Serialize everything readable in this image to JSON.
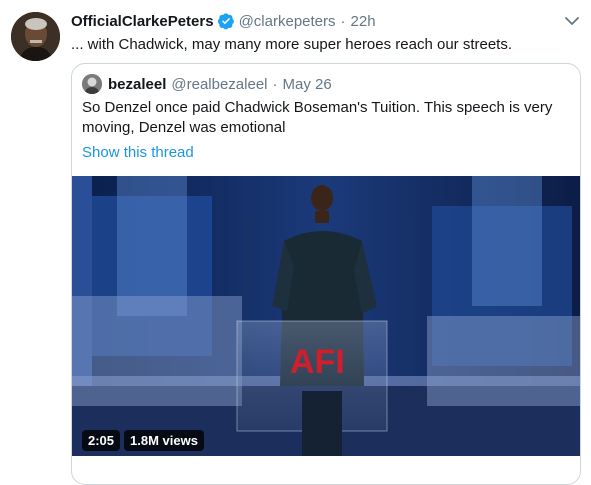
{
  "tweet": {
    "display_name": "OfficialClarkePeters",
    "handle": "@clarkepeters",
    "separator": "·",
    "time": "22h",
    "text": "... with Chadwick, may many more super heroes reach our streets."
  },
  "quoted": {
    "display_name": "bezaleel",
    "handle": "@realbezaleel",
    "separator": "·",
    "date": "May 26",
    "text": "So Denzel once paid Chadwick Boseman's Tuition. This speech is very moving, Denzel was emotional",
    "thread_link": "Show this thread"
  },
  "video": {
    "duration": "2:05",
    "views": "1.8M views",
    "podium_logo": "AFI"
  },
  "colors": {
    "link": "#1b95e0",
    "secondary_text": "#657786",
    "verified": "#1da1f2",
    "border": "#ccd6dd"
  },
  "icons": {
    "verified": "verified-badge-icon",
    "caret": "chevron-down-icon"
  }
}
